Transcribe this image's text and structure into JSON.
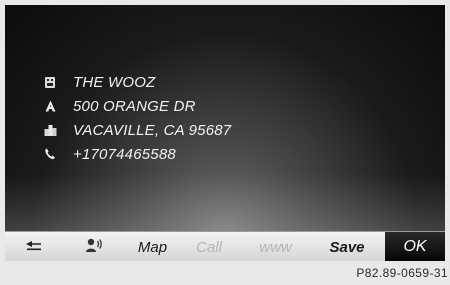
{
  "contact": {
    "name": "THE WOOZ",
    "street": "500 ORANGE DR",
    "city": "VACAVILLE, CA 95687",
    "phone": "+17074465588",
    "icons": {
      "name": "building-icon",
      "street": "address-icon",
      "city": "city-icon",
      "phone": "phone-icon"
    }
  },
  "menu": {
    "back_icon": "back-arrow-icon",
    "voice_icon": "voice-tag-icon",
    "map": "Map",
    "call": "Call",
    "www": "www",
    "save": "Save",
    "ok": "OK"
  },
  "footer": {
    "code": "P82.89-0659-31"
  },
  "colors": {
    "text": "#f2f2f2",
    "disabled": "#b4b4b4",
    "ok_bg": "#050505"
  }
}
